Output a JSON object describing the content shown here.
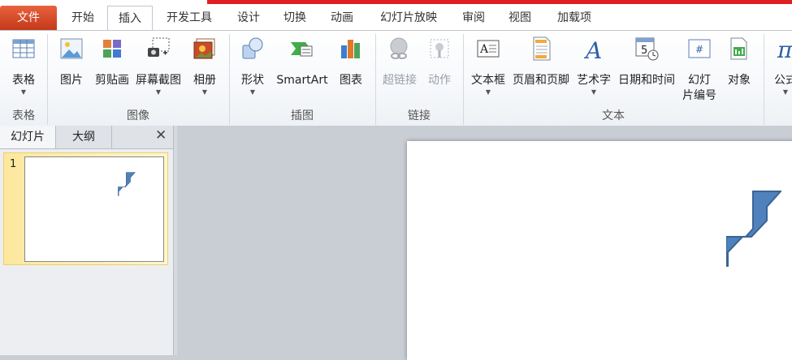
{
  "tabs": [
    "文件",
    "开始",
    "插入",
    "开发工具",
    "设计",
    "切换",
    "动画",
    "幻灯片放映",
    "审阅",
    "视图",
    "加载项"
  ],
  "active_tab": "插入",
  "ribbon": {
    "groups": {
      "table": "表格",
      "images": "图像",
      "illustrations": "插图",
      "links": "链接",
      "text": "文本"
    },
    "buttons": {
      "table": "表格",
      "picture": "图片",
      "clipart": "剪贴画",
      "screenshot": "屏幕截图",
      "album": "相册",
      "shapes": "形状",
      "smartart": "SmartArt",
      "chart": "图表",
      "hyperlink": "超链接",
      "action": "动作",
      "textbox": "文本框",
      "header_footer": "页眉和页脚",
      "wordart": "艺术字",
      "datetime": "日期和时间",
      "slide_number_line1": "幻灯",
      "slide_number_line2": "片编号",
      "object": "对象",
      "formula": "公式"
    }
  },
  "left_pane": {
    "tab_slides": "幻灯片",
    "tab_outline": "大纲",
    "close_symbol": "✕",
    "slide_number": "1"
  },
  "colors": {
    "accent_file_tab": "#d9532c",
    "shape_fill": "#4f81bd"
  }
}
